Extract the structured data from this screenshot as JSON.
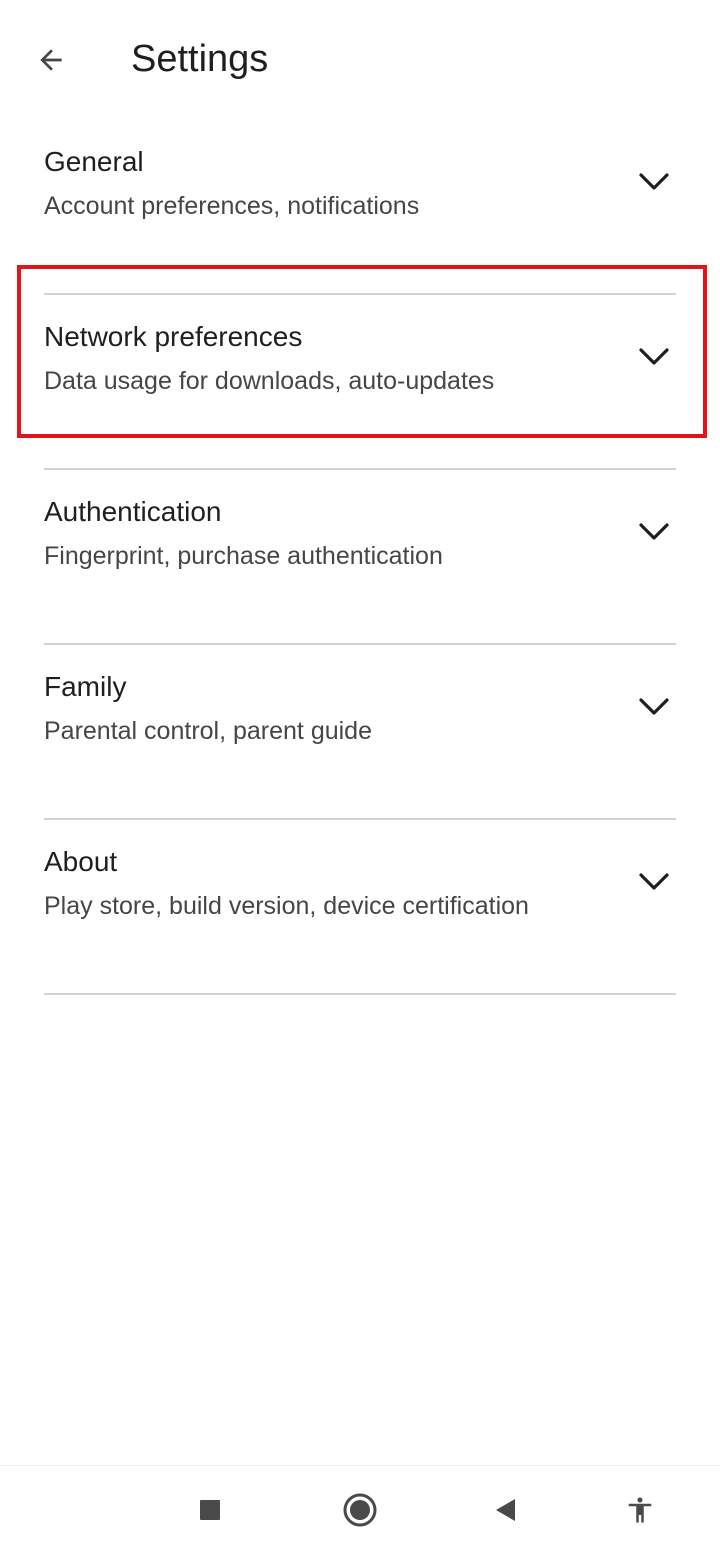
{
  "header": {
    "title": "Settings",
    "back_icon": "arrow-back-icon"
  },
  "settings": [
    {
      "title": "General",
      "subtitle": "Account preferences, notifications",
      "icon": "chevron-down-icon",
      "highlighted": false
    },
    {
      "title": "Network preferences",
      "subtitle": "Data usage for downloads, auto-updates",
      "icon": "chevron-down-icon",
      "highlighted": true
    },
    {
      "title": "Authentication",
      "subtitle": "Fingerprint, purchase authentication",
      "icon": "chevron-down-icon",
      "highlighted": false
    },
    {
      "title": "Family",
      "subtitle": "Parental control, parent guide",
      "icon": "chevron-down-icon",
      "highlighted": false
    },
    {
      "title": "About",
      "subtitle": "Play store, build version, device certification",
      "icon": "chevron-down-icon",
      "highlighted": false
    }
  ],
  "nav_bar": {
    "buttons": [
      "recents-square-icon",
      "home-circle-icon",
      "back-triangle-icon",
      "accessibility-icon"
    ]
  },
  "colors": {
    "highlight": "#e2141a",
    "text_primary": "#1f1f1f",
    "text_secondary": "#444746",
    "divider": "#d3d3d3",
    "nav_icon": "#4a4a4a"
  }
}
